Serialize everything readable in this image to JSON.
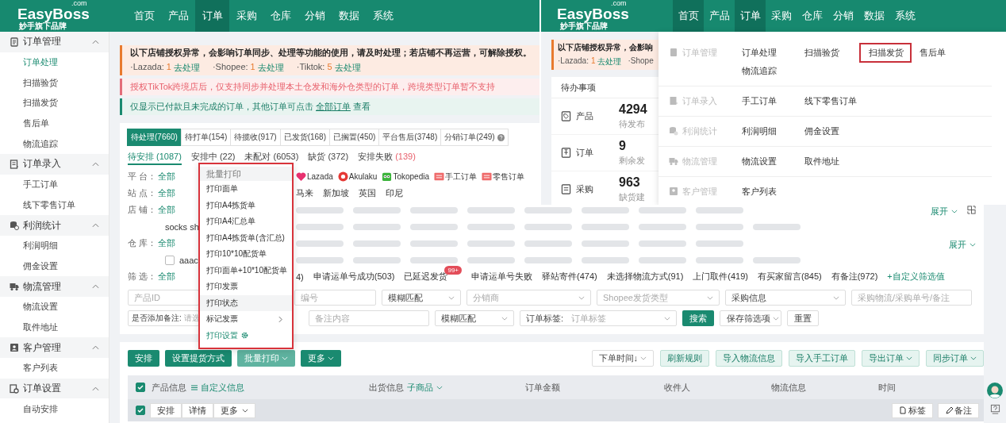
{
  "main_view": {
    "logo": {
      "brand": "EasyBoss",
      "domain": ".com",
      "tagline": "妙手旗下品牌"
    },
    "nav": [
      {
        "label": "首页",
        "selected": false
      },
      {
        "label": "产品",
        "selected": false
      },
      {
        "label": "订单",
        "selected": true
      },
      {
        "label": "采购",
        "selected": false
      },
      {
        "label": "仓库",
        "selected": false
      },
      {
        "label": "分销",
        "selected": false
      },
      {
        "label": "数据",
        "selected": false
      },
      {
        "label": "系统",
        "selected": false
      }
    ],
    "sidebar": [
      {
        "title": "订单管理",
        "expanded": true,
        "items": [
          {
            "label": "订单处理",
            "selected": true
          },
          {
            "label": "扫描验货",
            "selected": false
          },
          {
            "label": "扫描发货",
            "selected": false
          },
          {
            "label": "售后单",
            "selected": false
          },
          {
            "label": "物流追踪",
            "selected": false
          }
        ]
      },
      {
        "title": "订单录入",
        "expanded": true,
        "items": [
          {
            "label": "手工订单",
            "selected": false
          },
          {
            "label": "线下零售订单",
            "selected": false
          }
        ]
      },
      {
        "title": "利润统计",
        "expanded": true,
        "items": [
          {
            "label": "利润明细",
            "selected": false
          },
          {
            "label": "佣金设置",
            "selected": false
          }
        ]
      },
      {
        "title": "物流管理",
        "expanded": true,
        "items": [
          {
            "label": "物流设置",
            "selected": false
          },
          {
            "label": "取件地址",
            "selected": false
          }
        ]
      },
      {
        "title": "客户管理",
        "expanded": true,
        "items": [
          {
            "label": "客户列表",
            "selected": false
          }
        ]
      },
      {
        "title": "订单设置",
        "expanded": true,
        "items": [
          {
            "label": "自动安排",
            "selected": false
          }
        ]
      }
    ],
    "alerts": [
      {
        "kind": "warning",
        "title": "以下店铺授权异常，会影响订单同步、处理等功能的使用，请及时处理；若店铺不再运营，可解除授权。",
        "stores": [
          {
            "name": "·Lazada:",
            "count": "1",
            "action": "去处理"
          },
          {
            "name": "·Shopee:",
            "count": "1",
            "action": "去处理"
          },
          {
            "name": "·Tiktok:",
            "count": "5",
            "action": "去处理"
          }
        ]
      },
      {
        "kind": "error",
        "text": "授权TikTok跨境店后，仅支持同步并处理本土仓发和海外仓类型的订单，跨境类型订单暂不支持"
      },
      {
        "kind": "info",
        "text": "仅显示已付款且未完成的订单，其他订单可点击",
        "link": "全部订单",
        "suffix": "查看"
      }
    ],
    "status_tabs": [
      {
        "label": "待处理(7660)",
        "selected": true,
        "help": false
      },
      {
        "label": "待打单(154)",
        "selected": false,
        "help": false
      },
      {
        "label": "待揽收(917)",
        "selected": false,
        "help": false
      },
      {
        "label": "已发货(168)",
        "selected": false,
        "help": false
      },
      {
        "label": "已搁置(450)",
        "selected": false,
        "help": false
      },
      {
        "label": "平台售后(3748)",
        "selected": false,
        "help": false
      },
      {
        "label": "分销订单(249)",
        "selected": false,
        "help": true
      }
    ],
    "sub_tabs": [
      {
        "label": "待安排",
        "count": "(1087)",
        "selected": true,
        "warn": false
      },
      {
        "label": "安排中",
        "count": "(22)",
        "selected": false,
        "warn": false
      },
      {
        "label": "未配对",
        "count": "(6053)",
        "selected": false,
        "warn": false
      },
      {
        "label": "缺货",
        "count": "(372)",
        "selected": false,
        "warn": false
      },
      {
        "label": "安排失败",
        "count": "(139)",
        "selected": false,
        "warn": true
      }
    ],
    "filters": [
      {
        "label": "平 台：",
        "all": "全部",
        "options": [
          {
            "kind": "logo",
            "text": "Lazada"
          },
          {
            "kind": "logo",
            "text": "Akulaku"
          },
          {
            "kind": "logo",
            "text": "Tokopedia"
          },
          {
            "kind": "logo",
            "text": "手工订单"
          },
          {
            "kind": "logo",
            "text": "零售订单"
          }
        ]
      },
      {
        "label": "站 点：",
        "all": "全部",
        "options": [
          {
            "kind": "text",
            "text": "马来"
          },
          {
            "kind": "text",
            "text": "新加坡"
          },
          {
            "kind": "text",
            "text": "英国"
          },
          {
            "kind": "text",
            "text": "印尼"
          }
        ]
      },
      {
        "label": "店 铺：",
        "all": "全部",
        "options": [
          {
            "kind": "blurred"
          },
          {
            "kind": "blurred"
          },
          {
            "kind": "blurred"
          },
          {
            "kind": "blurred"
          },
          {
            "kind": "blurred"
          },
          {
            "kind": "blurred"
          },
          {
            "kind": "blurred"
          },
          {
            "kind": "blurred"
          }
        ],
        "expand": "展开",
        "layout_toggle": true
      },
      {
        "options": [
          {
            "kind": "text",
            "text": "socks sh"
          },
          {
            "kind": "blurred"
          },
          {
            "kind": "blurred"
          },
          {
            "kind": "blurred"
          },
          {
            "kind": "blurred"
          },
          {
            "kind": "blurred"
          },
          {
            "kind": "blurred"
          },
          {
            "kind": "blurred"
          },
          {
            "kind": "blurred"
          },
          {
            "kind": "blurred"
          }
        ]
      },
      {
        "label": "仓 库：",
        "all": "全部",
        "options": [
          {
            "kind": "blurred"
          },
          {
            "kind": "blurred"
          },
          {
            "kind": "blurred"
          },
          {
            "kind": "blurred"
          },
          {
            "kind": "blurred"
          },
          {
            "kind": "blurred"
          },
          {
            "kind": "blurred"
          },
          {
            "kind": "blurred"
          }
        ],
        "expand": "展开",
        "layout_toggle": false
      },
      {
        "options": [
          {
            "kind": "checkbox",
            "text": "aaac",
            "checked": false
          },
          {
            "kind": "blurred"
          },
          {
            "kind": "blurred"
          },
          {
            "kind": "blurred"
          },
          {
            "kind": "blurred"
          },
          {
            "kind": "blurred"
          },
          {
            "kind": "blurred"
          },
          {
            "kind": "blurred"
          },
          {
            "kind": "blurred"
          },
          {
            "kind": "blurred"
          }
        ]
      },
      {
        "label": "筛 选：",
        "all": "全部",
        "options": [
          {
            "kind": "text",
            "text": "4)"
          },
          {
            "kind": "text",
            "text": "申请运单号成功(503)"
          },
          {
            "kind": "badge",
            "text": "已延迟发货",
            "badge": "99+"
          },
          {
            "kind": "text",
            "text": "申请运单号失败"
          },
          {
            "kind": "text",
            "text": "驿站寄件(474)"
          },
          {
            "kind": "text",
            "text": "未选择物流方式(91)"
          },
          {
            "kind": "text",
            "text": "上门取件(419)"
          },
          {
            "kind": "text",
            "text": "有买家留言(845)"
          },
          {
            "kind": "text",
            "text": "有备注(972)"
          },
          {
            "kind": "add",
            "text": "+自定义筛选值"
          }
        ]
      }
    ],
    "search_rows": [
      [
        {
          "kind": "input",
          "placeholder": "产品ID"
        },
        {
          "kind": "input",
          "placeholder": "编号"
        },
        {
          "kind": "select",
          "value": "模糊匹配"
        },
        {
          "kind": "select",
          "placeholder": "分销商"
        },
        {
          "kind": "select",
          "placeholder": "Shopee发货类型"
        },
        {
          "kind": "select",
          "value": "采购信息"
        },
        {
          "kind": "input",
          "placeholder": "采购物流/采购单号/备注"
        }
      ],
      [
        {
          "kind": "labeled",
          "label": "是否添加备注:",
          "placeholder": "请选"
        },
        {
          "kind": "input",
          "placeholder": "备注内容"
        },
        {
          "kind": "select",
          "value": "模糊匹配"
        },
        {
          "kind": "labeled",
          "label": "订单标签:",
          "placeholder": "订单标签"
        },
        {
          "kind": "primary",
          "value": "搜索"
        },
        {
          "kind": "split",
          "value": "保存筛选项"
        },
        {
          "kind": "button",
          "value": "重置"
        }
      ]
    ],
    "actions": {
      "left": [
        {
          "label": "安排",
          "kind": "button",
          "open": false
        },
        {
          "label": "设置提货方式",
          "kind": "button",
          "open": false
        },
        {
          "label": "批量打印",
          "kind": "dropdown",
          "open": true
        },
        {
          "label": "更多",
          "kind": "dropdown",
          "open": false
        }
      ],
      "right": [
        {
          "label": "下单时间↓",
          "kind": "select"
        },
        {
          "label": "刷新规则",
          "kind": "button"
        },
        {
          "label": "导入物流信息",
          "kind": "button"
        },
        {
          "label": "导入手工订单",
          "kind": "button"
        },
        {
          "label": "导出订单",
          "kind": "dropdown"
        },
        {
          "label": "同步订单",
          "kind": "dropdown"
        }
      ]
    },
    "table": {
      "select_all": true,
      "columns": [
        {
          "label": "产品信息",
          "link": "自定义信息"
        },
        {
          "label": "出货信息",
          "link": "子商品"
        },
        {
          "label": "订单金额"
        },
        {
          "label": "收件人"
        },
        {
          "label": "物流信息"
        },
        {
          "label": "时间"
        }
      ],
      "row": {
        "checked": true,
        "buttons": [
          "安排",
          "详情",
          "更多"
        ],
        "tools": [
          "标签",
          "备注"
        ]
      }
    },
    "print_menu": {
      "title": "批量打印",
      "highlighted": true,
      "items": [
        {
          "label": "打印面单",
          "kind": "item",
          "hovered": false
        },
        {
          "label": "打印A4拣货单",
          "kind": "item",
          "hovered": false
        },
        {
          "label": "打印A4汇总单",
          "kind": "item",
          "hovered": false
        },
        {
          "label": "打印A4拣货单(含汇总)",
          "kind": "item",
          "hovered": false
        },
        {
          "label": "打印10*10配货单",
          "kind": "item",
          "hovered": false
        },
        {
          "label": "打印面单+10*10配货单",
          "kind": "item",
          "hovered": false
        },
        {
          "label": "打印发票",
          "kind": "item",
          "hovered": false
        },
        {
          "label": "打印状态",
          "kind": "item",
          "hovered": true
        },
        {
          "label": "标记发票",
          "kind": "submenu",
          "hovered": false
        },
        {
          "label": "打印设置",
          "kind": "settings",
          "hovered": false
        }
      ]
    }
  },
  "second_view": {
    "logo": {
      "brand": "EasyBoss",
      "domain": ".com",
      "tagline": "妙手旗下品牌"
    },
    "nav": [
      {
        "label": "首页",
        "highlighted": true
      },
      {
        "label": "产品",
        "highlighted": false
      },
      {
        "label": "订单",
        "highlighted": true
      },
      {
        "label": "采购",
        "highlighted": false
      },
      {
        "label": "仓库",
        "highlighted": false
      },
      {
        "label": "分销",
        "highlighted": false
      },
      {
        "label": "数据",
        "highlighted": false
      },
      {
        "label": "系统",
        "highlighted": false
      }
    ],
    "alert": {
      "title": "以下店铺授权异常，会影响",
      "stores": [
        {
          "name": "·Lazada:",
          "count": "1",
          "action": "去处理"
        },
        {
          "name": "·Shope"
        }
      ]
    },
    "todo": {
      "title": "待办事项",
      "items": [
        {
          "label": "产品",
          "value": "4294",
          "caption": "待发布"
        },
        {
          "label": "订单",
          "value": "9",
          "caption": "剩余发"
        },
        {
          "label": "采购",
          "value": "963",
          "caption": "缺货建"
        }
      ]
    },
    "mega_menu": [
      {
        "group": "订单管理",
        "items": [
          {
            "label": "订单处理",
            "highlighted": false
          },
          {
            "label": "扫描验货",
            "highlighted": false
          },
          {
            "label": "扫描发货",
            "highlighted": true
          },
          {
            "label": "售后单",
            "highlighted": false
          },
          {
            "label": "物流追踪",
            "highlighted": false
          }
        ]
      },
      {
        "group": "订单录入",
        "items": [
          {
            "label": "手工订单",
            "highlighted": false
          },
          {
            "label": "线下零售订单",
            "highlighted": false
          }
        ]
      },
      {
        "group": "利润统计",
        "items": [
          {
            "label": "利润明细",
            "highlighted": false
          },
          {
            "label": "佣金设置",
            "highlighted": false
          }
        ]
      },
      {
        "group": "物流管理",
        "items": [
          {
            "label": "物流设置",
            "highlighted": false
          },
          {
            "label": "取件地址",
            "highlighted": false
          }
        ]
      },
      {
        "group": "客户管理",
        "items": [
          {
            "label": "客户列表",
            "highlighted": false
          }
        ]
      }
    ]
  }
}
